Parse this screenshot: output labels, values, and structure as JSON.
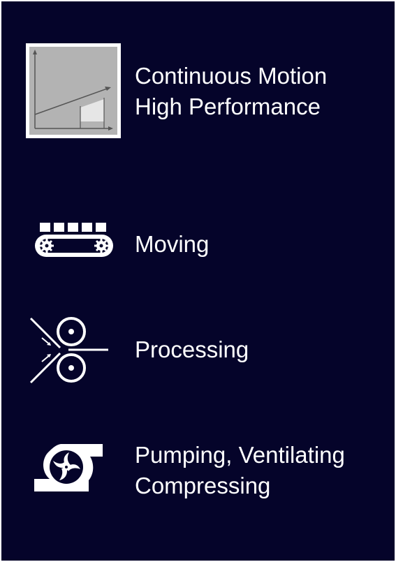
{
  "colors": {
    "background": "#05042a",
    "text": "#ffffff",
    "chart_icon_frame": "#ffffff",
    "chart_icon_fill": "#b3b3b3",
    "chart_icon_highlight": "#e6e6e6",
    "chart_icon_lines": "#555555"
  },
  "items": [
    {
      "icon": "speed-profile-chart-icon",
      "lines": [
        "Continuous Motion",
        "High Performance"
      ]
    },
    {
      "icon": "conveyor-belt-icon",
      "lines": [
        "Moving"
      ]
    },
    {
      "icon": "rollers-processing-icon",
      "lines": [
        "Processing"
      ]
    },
    {
      "icon": "pump-fan-icon",
      "lines": [
        "Pumping, Ventilating",
        "Compressing"
      ]
    }
  ]
}
